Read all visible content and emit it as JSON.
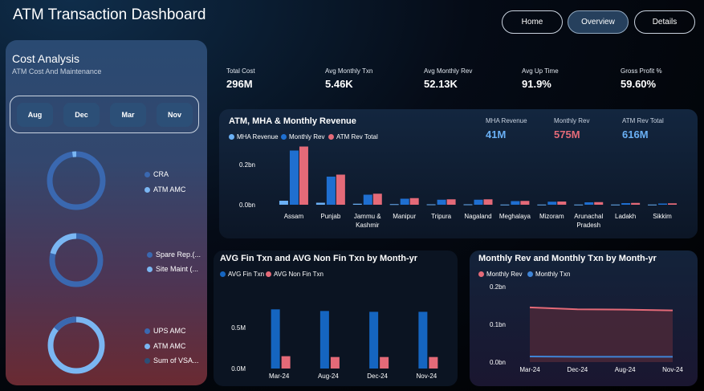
{
  "header": {
    "title": "ATM Transaction Dashboard",
    "nav": [
      "Home",
      "Overview",
      "Details"
    ],
    "active_nav": "Overview"
  },
  "cost_panel": {
    "title": "Cost Analysis",
    "subtitle": "ATM Cost And Maintenance",
    "months": [
      "Aug",
      "Dec",
      "Mar",
      "Nov"
    ],
    "donut1_legend": [
      "CRA",
      "ATM AMC"
    ],
    "donut2_legend": [
      "Spare Rep.(...",
      "Site Maint (..."
    ],
    "donut3_legend": [
      "UPS AMC",
      "ATM AMC",
      "Sum of VSA..."
    ]
  },
  "kpis": [
    {
      "label": "Total Cost",
      "value": "296M"
    },
    {
      "label": "Avg Monthly Txn",
      "value": "5.46K"
    },
    {
      "label": "Avg Monthly Rev",
      "value": "52.13K"
    },
    {
      "label": "Avg Up Time",
      "value": "91.9%"
    },
    {
      "label": "Gross Profit %",
      "value": "59.60%"
    }
  ],
  "revenue_card": {
    "title": "ATM, MHA & Monthly Revenue",
    "legend": [
      "MHA Revenue",
      "Monthly Rev",
      "ATM Rev Total"
    ],
    "summary": [
      {
        "label": "MHA Revenue",
        "value": "41M"
      },
      {
        "label": "Monthly Rev",
        "value": "575M"
      },
      {
        "label": "ATM Rev Total",
        "value": "616M"
      }
    ]
  },
  "fin_card": {
    "title": "AVG Fin Txn and AVG Non Fin Txn by Month-yr",
    "legend": [
      "AVG Fin Txn",
      "AVG Non Fin Txn"
    ]
  },
  "monthly_card": {
    "title": "Monthly Rev and Monthly Txn by Month-yr",
    "legend": [
      "Monthly Rev",
      "Monthly Txn"
    ]
  },
  "colors": {
    "mha": "#6ab0f5",
    "monthly": "#1f6fd0",
    "atm_total": "#e46a78",
    "fin": "#1565c0",
    "nonfin": "#e46a78",
    "line_rev": "#e46a78",
    "line_txn": "#3f84d6"
  },
  "chart_data": [
    {
      "type": "bar",
      "title": "ATM, MHA & Monthly Revenue",
      "categories": [
        "Assam",
        "Punjab",
        "Jammu & Kashmir",
        "Manipur",
        "Tripura",
        "Nagaland",
        "Meghalaya",
        "Mizoram",
        "Arunachal Pradesh",
        "Ladakh",
        "Sikkim"
      ],
      "series": [
        {
          "name": "MHA Revenue",
          "values": [
            0.02,
            0.01,
            0.005,
            0.003,
            0.002,
            0.002,
            0.001,
            0.001,
            0.001,
            0.001,
            0.001
          ]
        },
        {
          "name": "Monthly Rev",
          "values": [
            0.27,
            0.14,
            0.05,
            0.03,
            0.025,
            0.025,
            0.018,
            0.015,
            0.012,
            0.008,
            0.006
          ]
        },
        {
          "name": "ATM Rev Total",
          "values": [
            0.29,
            0.15,
            0.055,
            0.033,
            0.027,
            0.027,
            0.019,
            0.016,
            0.013,
            0.009,
            0.007
          ]
        }
      ],
      "yticks": [
        "0.2bn",
        "0.0bn"
      ],
      "ylim": [
        0,
        0.3
      ]
    },
    {
      "type": "bar",
      "title": "AVG Fin Txn and AVG Non Fin Txn by Month-yr",
      "categories": [
        "Mar-24",
        "Aug-24",
        "Dec-24",
        "Nov-24"
      ],
      "series": [
        {
          "name": "AVG Fin Txn",
          "values": [
            0.72,
            0.7,
            0.69,
            0.69
          ]
        },
        {
          "name": "AVG Non Fin Txn",
          "values": [
            0.15,
            0.14,
            0.14,
            0.14
          ]
        }
      ],
      "yticks": [
        "0.5M",
        "0.0M"
      ],
      "ylim": [
        0,
        0.85
      ]
    },
    {
      "type": "area",
      "title": "Monthly Rev and Monthly Txn by Month-yr",
      "categories": [
        "Mar-24",
        "Dec-24",
        "Aug-24",
        "Nov-24"
      ],
      "series": [
        {
          "name": "Monthly Rev",
          "values": [
            0.145,
            0.14,
            0.139,
            0.137
          ]
        },
        {
          "name": "Monthly Txn",
          "values": [
            0.015,
            0.014,
            0.014,
            0.014
          ]
        }
      ],
      "yticks": [
        "0.2bn",
        "0.1bn",
        "0.0bn"
      ],
      "ylim": [
        0,
        0.2
      ]
    }
  ]
}
